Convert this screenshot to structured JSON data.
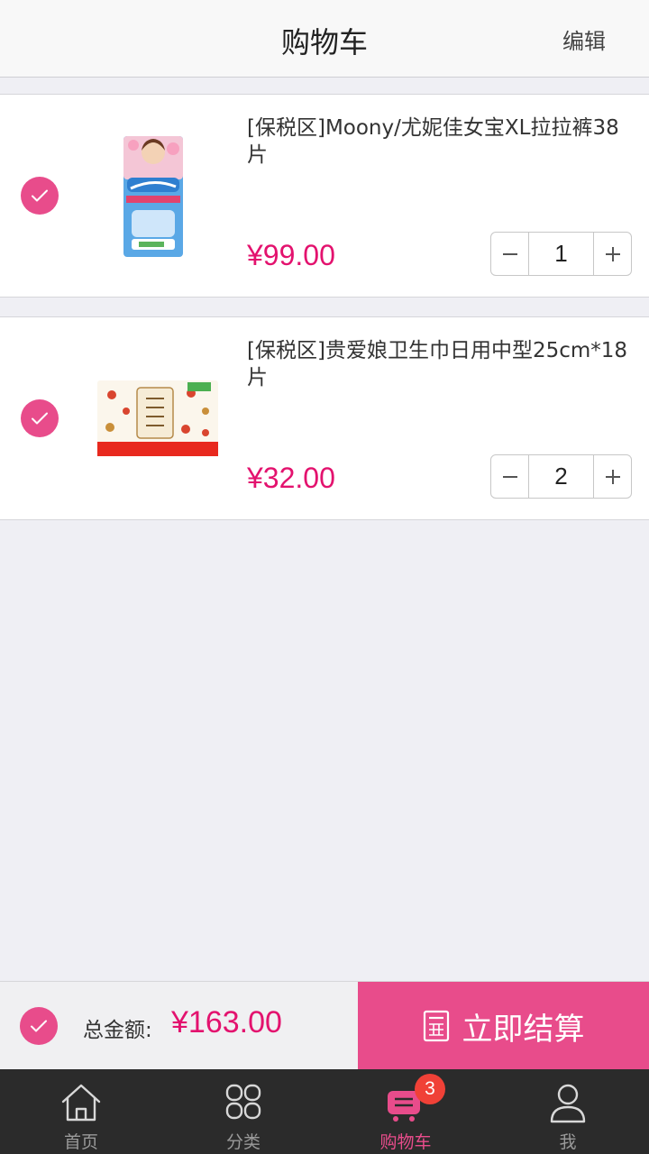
{
  "header": {
    "title": "购物车",
    "edit_label": "编辑"
  },
  "cart": {
    "items": [
      {
        "title": "[保税区]Moony/尤妮佳女宝XL拉拉裤38片",
        "price": "¥99.00",
        "quantity": "1",
        "checked": true
      },
      {
        "title": "[保税区]贵爱娘卫生巾日用中型25cm*18片",
        "price": "¥32.00",
        "quantity": "2",
        "checked": true
      }
    ]
  },
  "footer": {
    "total_label": "总金额:",
    "total_value": "¥163.00",
    "checkout_label": "立即结算"
  },
  "tabbar": {
    "items": [
      {
        "label": "首页",
        "icon": "home-icon"
      },
      {
        "label": "分类",
        "icon": "grid-icon"
      },
      {
        "label": "购物车",
        "icon": "cart-icon",
        "active": true
      },
      {
        "label": "我",
        "icon": "user-icon"
      }
    ],
    "cart_badge": "3"
  },
  "colors": {
    "accent": "#e84c8b",
    "price": "#e3126e",
    "tabbar_bg": "#2b2b2b",
    "badge": "#f04137"
  }
}
